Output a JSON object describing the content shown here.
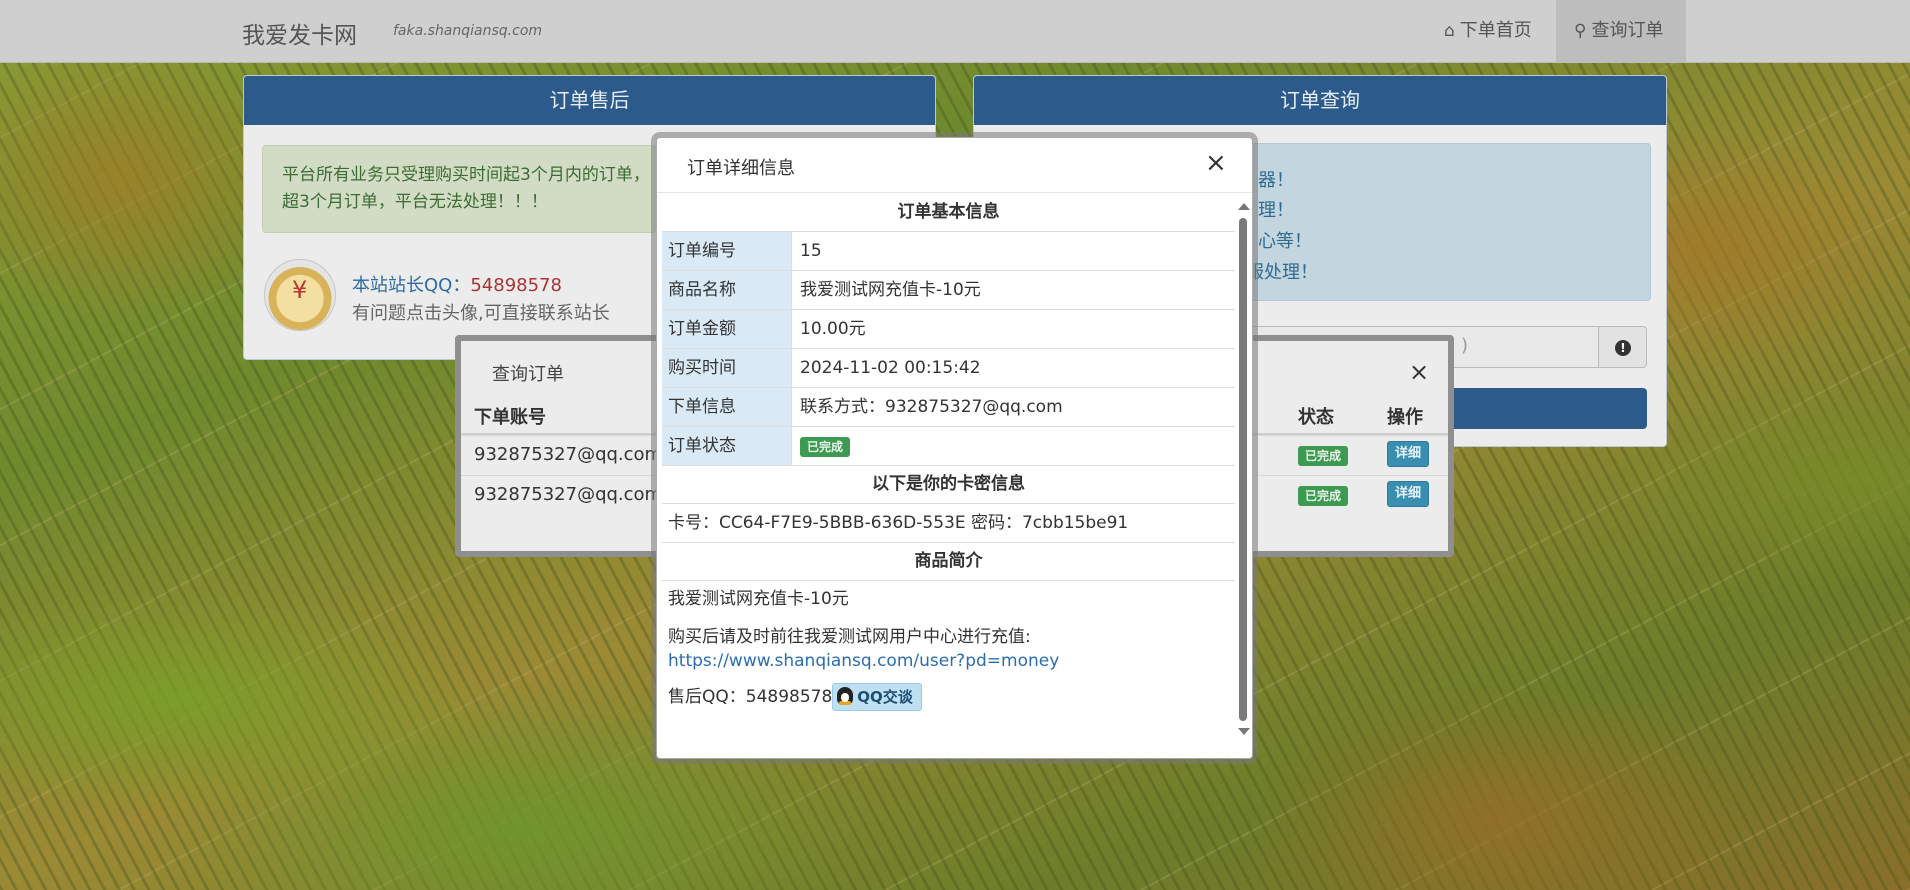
{
  "navbar": {
    "brand": "我爱发卡网",
    "domain": "faka.shanqiansq.com",
    "home_label": "下单首页",
    "home_icon": "home-icon",
    "order_label": "查询订单",
    "order_icon": "search-icon"
  },
  "aftersale_panel": {
    "title": "订单售后",
    "notice": "平台所有业务只受理购买时间起3个月内的订单，超3个月订单，平台无法处理！！！",
    "qq_label": "本站站长QQ：",
    "qq_number": "54898578",
    "tip": "有问题点击头像,可直接联系站长"
  },
  "query_panel": {
    "title": "订单查询",
    "notice_lines": [
      "器！",
      "理！",
      "心等！",
      "服处理！"
    ],
    "input_partial": ")",
    "info_icon": "info-icon"
  },
  "query_modal": {
    "title": "查询订单",
    "columns": {
      "account": "下单账号",
      "status": "状态",
      "action": "操作"
    },
    "rows": [
      {
        "account": "932875327@qq.com",
        "status": "已完成",
        "action": "详细"
      },
      {
        "account": "932875327@qq.com",
        "status": "已完成",
        "action": "详细"
      }
    ]
  },
  "detail_modal": {
    "title": "订单详细信息",
    "close": "×",
    "basic_title": "订单基本信息",
    "fields": [
      {
        "key": "订单编号",
        "value": "15"
      },
      {
        "key": "商品名称",
        "value": "我爱测试网充值卡-10元"
      },
      {
        "key": "订单金额",
        "value": "10.00元"
      },
      {
        "key": "购买时间",
        "value": "2024-11-02 00:15:42"
      },
      {
        "key": "下单信息",
        "value": "联系方式：932875327@qq.com"
      }
    ],
    "status_key": "订单状态",
    "status_value": "已完成",
    "card_title": "以下是你的卡密信息",
    "card_line": "卡号：CC64-F7E9-5BBB-636D-553E 密码：7cbb15be91",
    "intro_title": "商品简介",
    "intro_name": "我爱测试网充值卡-10元",
    "intro_text": "购买后请及时前往我爱测试网用户中心进行充值:",
    "intro_link": "https://www.shanqiansq.com/user?pd=money",
    "aftersale_qq_label": "售后QQ：54898578",
    "qq_button": "QQ交谈"
  }
}
